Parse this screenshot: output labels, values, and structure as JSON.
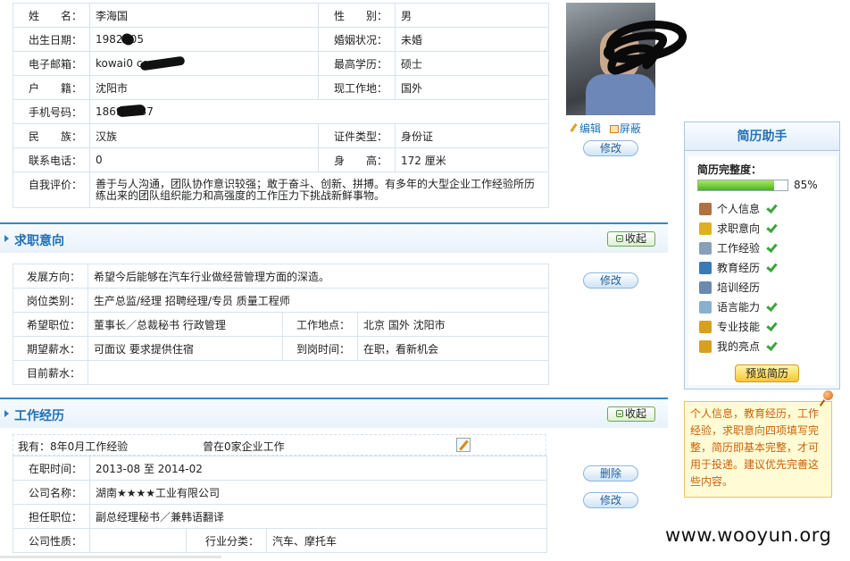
{
  "personal": {
    "rows": [
      {
        "label1": "姓　　名：",
        "value1": "李海国",
        "label2": "性　　别：",
        "value2": "男"
      },
      {
        "label1": "出生日期：",
        "value1": "1982   -05",
        "label2": "婚姻状况：",
        "value2": "未婚"
      },
      {
        "label1": "电子邮箱：",
        "value1": "kowai0          com",
        "label2": "最高学历：",
        "value2": "硕士"
      },
      {
        "label1": "户　　籍：",
        "value1": "沈阳市",
        "label2": "现工作地：",
        "value2": "国外"
      },
      {
        "label1": "手机号码：",
        "value1": "1869     3737"
      },
      {
        "label1": "民　　族：",
        "value1": "汉族",
        "label2": "证件类型：",
        "value2": "身份证"
      },
      {
        "label1": "联系电话：",
        "value1": "0",
        "label2": "身　　高：",
        "value2": "172 厘米"
      }
    ],
    "self_eval_label": "自我评价：",
    "self_eval": "善于与人沟通，团队协作意识较强；敢于奋斗、创新、拼搏。有多年的大型企业工作经验所历练出来的团队组织能力和高强度的工作压力下挑战新鲜事物。"
  },
  "photo_actions": {
    "edit": "编辑",
    "hide": "屏蔽"
  },
  "buttons": {
    "modify": "修改",
    "delete": "删除",
    "collapse": "收起",
    "preview": "预览简历"
  },
  "job_intent": {
    "title": "求职意向",
    "direction_label": "发展方向：",
    "direction": "希望今后能够在汽车行业做经营管理方面的深造。",
    "category_label": "岗位类别：",
    "category": "生产总监/经理  招聘经理/专员  质量工程师",
    "position_label": "希望职位：",
    "position": "董事长／总裁秘书  行政管理",
    "location_label": "工作地点：",
    "location": "北京  国外  沈阳市",
    "salary_label": "期望薪水：",
    "salary": "可面议  要求提供住宿",
    "arrival_label": "到岗时间：",
    "arrival": "在职，看新机会",
    "current_salary_label": "目前薪水：",
    "current_salary": ""
  },
  "work": {
    "title": "工作经历",
    "summary_left": "我有：8年0月工作经验",
    "summary_right": "曾在0家企业工作",
    "period_label": "在职时间：",
    "period": "2013-08 至 2014-02",
    "company_label": "公司名称：",
    "company": "湖南★★★★工业有限公司",
    "role_label": "担任职位：",
    "role": "副总经理秘书／兼韩语翻译",
    "nature_label": "公司性质：",
    "nature": "",
    "industry_label": "行业分类：",
    "industry": "汽车、摩托车"
  },
  "helper": {
    "title": "简历助手",
    "completeness_label": "简历完整度：",
    "completeness_pct": 85,
    "completeness_text": "85%",
    "items": [
      {
        "label": "个人信息",
        "icon": "person-card-icon",
        "done": true,
        "color": "#b07040"
      },
      {
        "label": "求职意向",
        "icon": "target-icon",
        "done": true,
        "color": "#e0b020"
      },
      {
        "label": "工作经验",
        "icon": "calendar-icon",
        "done": true,
        "color": "#8aa0b8"
      },
      {
        "label": "教育经历",
        "icon": "book-icon",
        "done": true,
        "color": "#3a7ab8"
      },
      {
        "label": "培训经历",
        "icon": "pen-icon",
        "done": false,
        "color": "#6a8ab0"
      },
      {
        "label": "语言能力",
        "icon": "document-icon",
        "done": true,
        "color": "#8ab0d0"
      },
      {
        "label": "专业技能",
        "icon": "skill-icon",
        "done": true,
        "color": "#d8a020"
      },
      {
        "label": "我的亮点",
        "icon": "highlight-icon",
        "done": true,
        "color": "#d8a020"
      }
    ]
  },
  "note": "个人信息，教育经历，工作经验，求职意向四项填写完整，简历即基本完整，才可用于投递。建议优先完善这些内容。",
  "watermark": "www.wooyun.org",
  "colors": {
    "accent": "#1f6fb5",
    "section_border": "#3a85c7",
    "note_text": "#c8620c"
  }
}
